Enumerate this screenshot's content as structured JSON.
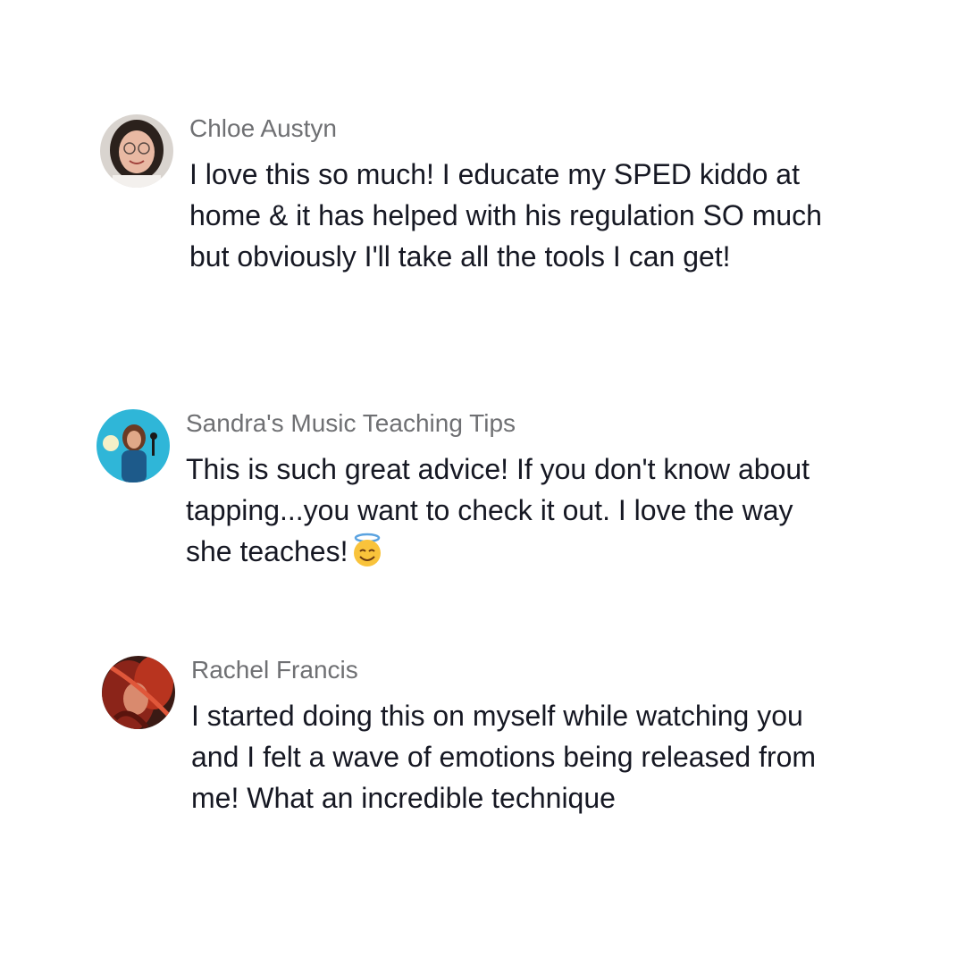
{
  "comments": [
    {
      "username": "Chloe Austyn",
      "text": "I love this so much! I educate my SPED kiddo at home & it has helped with his regulation SO much but obviously I'll take all the tools I can get!",
      "avatar_icon": "avatar-chloe-austyn"
    },
    {
      "username": "Sandra's Music Teaching Tips",
      "text": "This is such great advice! If you don't know about tapping...you want to check it out. I love the way she teaches!",
      "emoji": "smiling-face-with-halo-emoji",
      "avatar_icon": "avatar-sandras-music-teaching-tips"
    },
    {
      "username": "Rachel Francis",
      "text": "I started doing this on myself while watching you and I felt a wave of emotions being released from me! What an incredible technique",
      "avatar_icon": "avatar-rachel-francis"
    }
  ],
  "colors": {
    "background": "#ffffff",
    "username": "#6f7073",
    "text": "#161823"
  }
}
